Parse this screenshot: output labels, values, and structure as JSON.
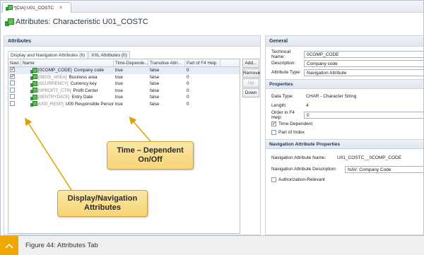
{
  "editor_tab": {
    "label": "*[CIA] U01_COSTC",
    "close": "✕"
  },
  "editor_title": "Attributes: Characteristic U01_COSTC",
  "attributes_section": {
    "title": "Attributes",
    "subtabs": [
      "Display and Navigation Attributes (6)",
      "XXL Attributes (0)"
    ],
    "columns": [
      "Navi...",
      "Name",
      "Time-Depende...",
      "Transitive Attri...",
      "Part of F4 Help"
    ],
    "rows": [
      {
        "nav": true,
        "key": "[0COMP_CODE]",
        "desc": "Company code",
        "time_dep": "true",
        "transitive": "false",
        "f4": "0",
        "greyed": false
      },
      {
        "nav": true,
        "key": "[0BUS_AREA]",
        "desc": "Business area",
        "time_dep": "true",
        "transitive": "false",
        "f4": "0",
        "greyed": true
      },
      {
        "nav": false,
        "key": "[0CURRENCY]",
        "desc": "Currency key",
        "time_dep": "true",
        "transitive": "false",
        "f4": "0",
        "greyed": true
      },
      {
        "nav": false,
        "key": "[0PROFIT_CTR]",
        "desc": "Profit Center",
        "time_dep": "true",
        "transitive": "false",
        "f4": "0",
        "greyed": true
      },
      {
        "nav": false,
        "key": "[0ENTRYDATE]",
        "desc": "Entry Date",
        "time_dep": "true",
        "transitive": "false",
        "f4": "0",
        "greyed": true
      },
      {
        "nav": false,
        "key": "[U00_RESP]",
        "desc": "U00 Responsible Person",
        "time_dep": "true",
        "transitive": "false",
        "f4": "0",
        "greyed": true
      }
    ],
    "buttons": {
      "add": "Add...",
      "remove": "Remove",
      "up": "Up",
      "down": "Down"
    }
  },
  "general": {
    "title": "General",
    "technical_name_label": "Technical Name:",
    "technical_name_value": "0COMP_CODE",
    "description_label": "Description:",
    "description_value": "Company code",
    "attribute_type_label": "Attribute Type:",
    "attribute_type_value": "Navigation Attribute"
  },
  "properties": {
    "title": "Properties",
    "data_type_label": "Data Type:",
    "data_type_value": "CHAR - Character String",
    "length_label": "Length:",
    "length_value": "4",
    "order_label": "Order in F4 Help:",
    "order_value": "0",
    "time_dependent_label": "Time-Dependent",
    "time_dependent_checked": true,
    "part_of_index_label": "Part of Index",
    "part_of_index_checked": false
  },
  "nav_properties": {
    "title": "Navigation Attribute Properties",
    "nav_name_label": "Navigation Attribute Name:",
    "nav_name_value": "U01_COSTC__0COMP_CODE",
    "nav_desc_label": "Navigation Attribute Description:",
    "nav_desc_value": "NAV: Company Code",
    "auth_label": "Authorization-Relevant",
    "auth_checked": false
  },
  "callouts": {
    "time_dependent": "Time – Dependent On/Off",
    "display_nav": "Display/Navigation Attributes"
  },
  "caption": "Figure 44: Attributes Tab",
  "colors": {
    "accent": "#f0a500",
    "callout": "#f7d476",
    "section_header": "#dfe6ee",
    "arrow": "#e0a200"
  }
}
